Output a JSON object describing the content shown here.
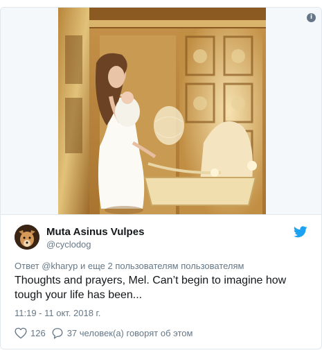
{
  "tweet": {
    "author_name": "Muta Asinus Vulpes",
    "author_handle": "@cyclodog",
    "reply_context": "Ответ @kharyp и еще 2 пользователям пользователям",
    "text": "Thoughts and prayers, Mel. Can’t begin to imagine how tough your life has been...",
    "timestamp": "11:19 - 11 окт. 2018 г.",
    "likes": "126",
    "talking": "37 человек(а) говорят об этом"
  },
  "icons": {
    "info": "info-icon",
    "brand": "twitter-bird-icon",
    "like": "heart-icon",
    "reply": "comment-bubble-icon"
  },
  "colors": {
    "brand": "#1da1f2",
    "secondary_text": "#657786",
    "primary_text": "#14171a",
    "border": "#e1e8ed"
  }
}
